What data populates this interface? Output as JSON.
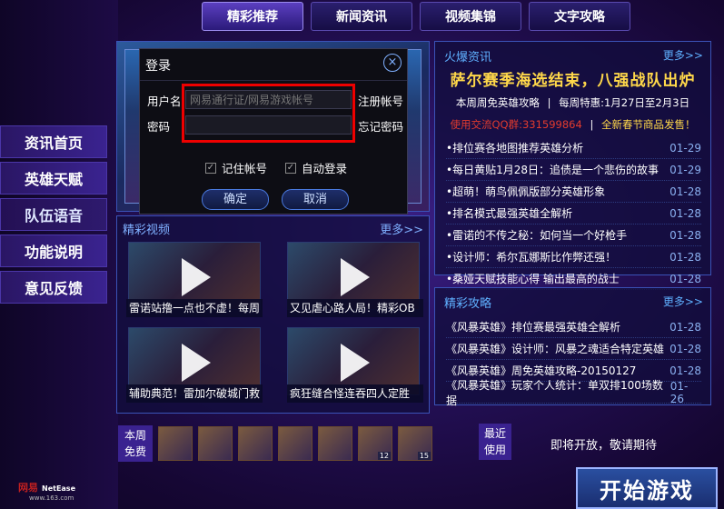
{
  "tabs": [
    "精彩推荐",
    "新闻资讯",
    "视频集锦",
    "文字攻略"
  ],
  "sidebar": [
    "资讯首页",
    "英雄天赋",
    "队伍语音",
    "功能说明",
    "意见反馈"
  ],
  "videos": {
    "title": "精彩视频",
    "more": "更多>>",
    "items": [
      "雷诺站撸一点也不虚！每周",
      "又见虐心路人局！精彩OB",
      "辅助典范！雷加尔破城门救",
      "疯狂缝合怪连吞四人定胜"
    ]
  },
  "hot": {
    "title": "火爆资讯",
    "more": "更多>>",
    "headline": "萨尔赛季海选结束，八强战队出炉",
    "sub_left": "本周周免英雄攻略",
    "sep": "|",
    "sub_right": "每周特惠:1月27日至2月3日",
    "qq": "使用交流QQ群:331599864",
    "sep2": "|",
    "newyear": "全新春节商品发售！",
    "list": [
      {
        "t": "•排位赛各地图推荐英雄分析",
        "d": "01-29"
      },
      {
        "t": "•每日黄贴1月28日：追债是一个悲伤的故事",
        "d": "01-29"
      },
      {
        "t": "•超萌！萌鸟佩佩版部分英雄形象",
        "d": "01-28"
      },
      {
        "t": "•排名模式最强英雄全解析",
        "d": "01-28"
      },
      {
        "t": "•雷诺的不传之秘：如何当一个好枪手",
        "d": "01-28"
      },
      {
        "t": "•设计师：希尔瓦娜斯比作弊还强！",
        "d": "01-28"
      },
      {
        "t": "•桑娅天赋技能心得 输出最高的战士",
        "d": "01-28"
      }
    ]
  },
  "guide": {
    "title": "精彩攻略",
    "more": "更多>>",
    "list": [
      {
        "t": "《风暴英雄》排位赛最强英雄全解析",
        "d": "01-28"
      },
      {
        "t": "《风暴英雄》设计师：风暴之魂适合特定英雄",
        "d": "01-28"
      },
      {
        "t": "《风暴英雄》周免英雄攻略-20150127",
        "d": "01-28"
      },
      {
        "t": "《风暴英雄》玩家个人统计：单双排100场数据",
        "d": "01-26"
      }
    ]
  },
  "free": {
    "l1": "本周",
    "l2": "免费",
    "badges": [
      "",
      "",
      "",
      "",
      "",
      "12",
      "15"
    ]
  },
  "recent": {
    "l1": "最近",
    "l2": "使用",
    "coming": "即将开放，敬请期待"
  },
  "logo": {
    "cn": "网易",
    "en": "NetEase",
    "url": "www.163.com"
  },
  "start": "开始游戏",
  "login": {
    "title": "登录",
    "user_label": "用户名",
    "user_placeholder": "网易通行证/网易游戏帐号",
    "register": "注册帐号",
    "pwd_label": "密码",
    "forgot": "忘记密码",
    "remember": "记住帐号",
    "auto": "自动登录",
    "ok": "确定",
    "cancel": "取消",
    "close": "×"
  }
}
